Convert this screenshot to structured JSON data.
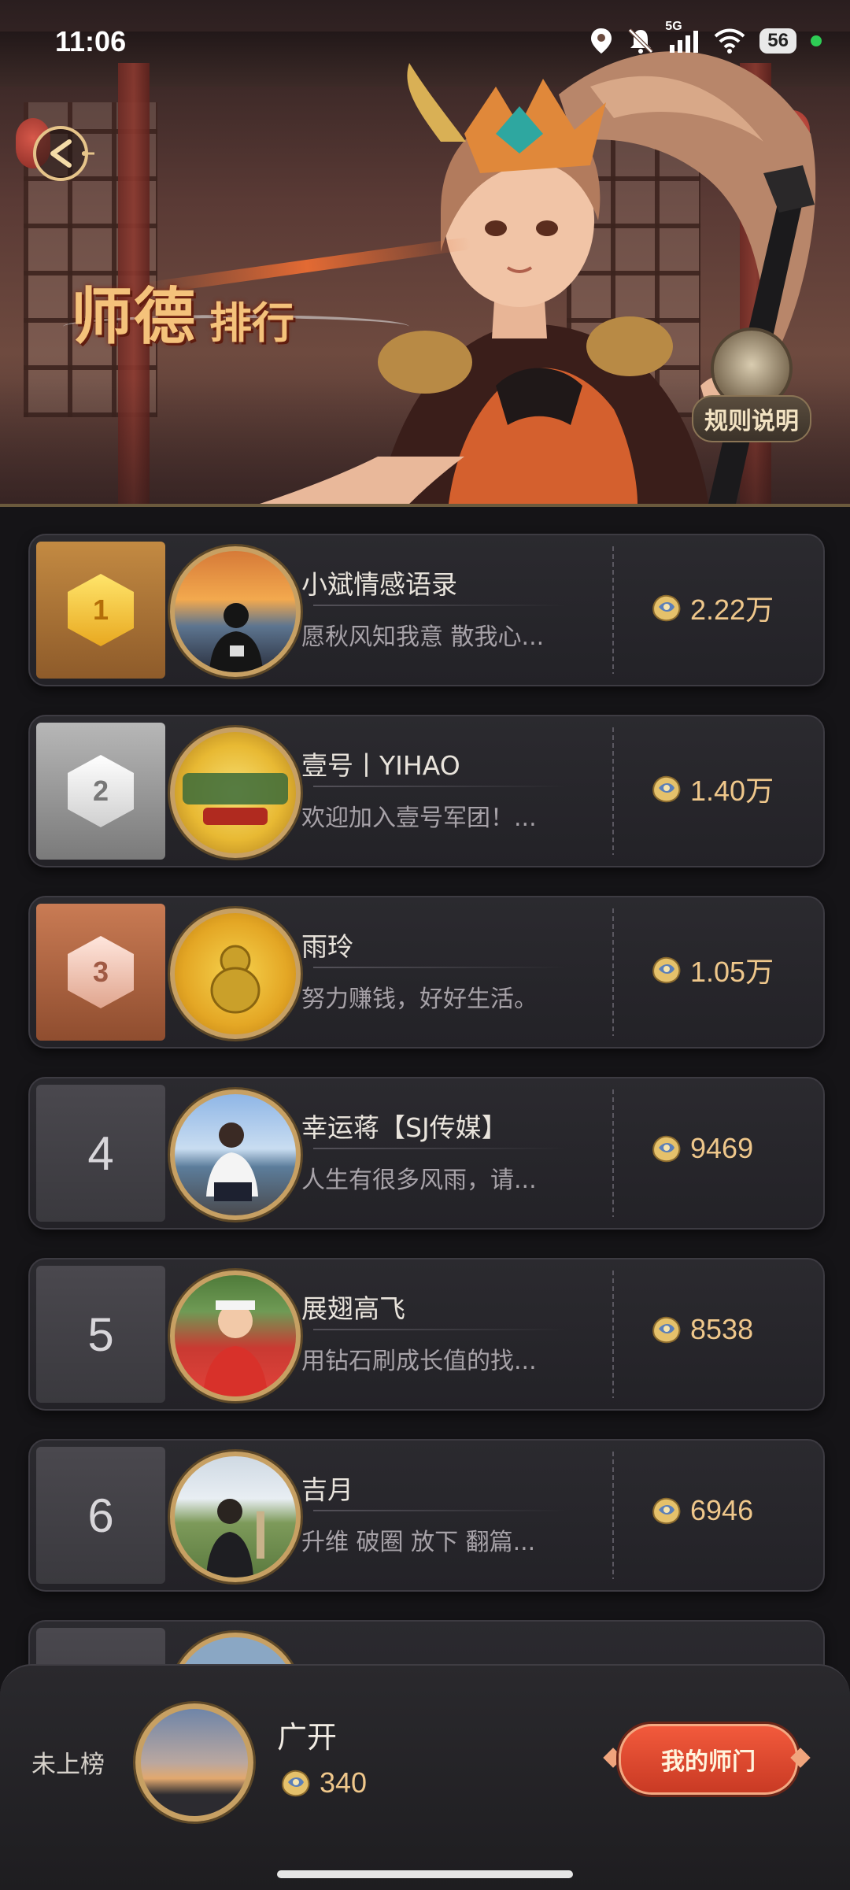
{
  "status_bar": {
    "time": "11:06",
    "network": "5G",
    "battery": "56",
    "icons": [
      "location-icon",
      "bell-muted-icon",
      "signal-icon",
      "wifi-icon"
    ]
  },
  "header": {
    "title_main": "师德",
    "title_sub": "排行",
    "rules_label": "规则说明"
  },
  "leaderboard": [
    {
      "rank": "1",
      "name": "小斌情感语录",
      "motto": "愿秋风知我意 散我心...",
      "score": "2.22万",
      "rank_style": "gold"
    },
    {
      "rank": "2",
      "name": "壹号丨YIHAO",
      "motto": "欢迎加入壹号军团！...",
      "score": "1.40万",
      "rank_style": "silver"
    },
    {
      "rank": "3",
      "name": "雨玲",
      "motto": "努力赚钱，好好生活。",
      "score": "1.05万",
      "rank_style": "bronze"
    },
    {
      "rank": "4",
      "name": "幸运蒋【SJ传媒】",
      "motto": "人生有很多风雨，请...",
      "score": "9469",
      "rank_style": "plain"
    },
    {
      "rank": "5",
      "name": "展翅高飞",
      "motto": "用钻石刷成长值的找...",
      "score": "8538",
      "rank_style": "plain"
    },
    {
      "rank": "6",
      "name": "吉月",
      "motto": "升维 破圈 放下 翻篇...",
      "score": "6946",
      "rank_style": "plain"
    }
  ],
  "my_entry": {
    "status": "未上榜",
    "name": "广开",
    "score": "340",
    "button_label": "我的师门"
  },
  "colors": {
    "accent_gold": "#c7a063",
    "score_color": "#efc78b",
    "button_red": "#e04a30",
    "background": "#151417"
  }
}
